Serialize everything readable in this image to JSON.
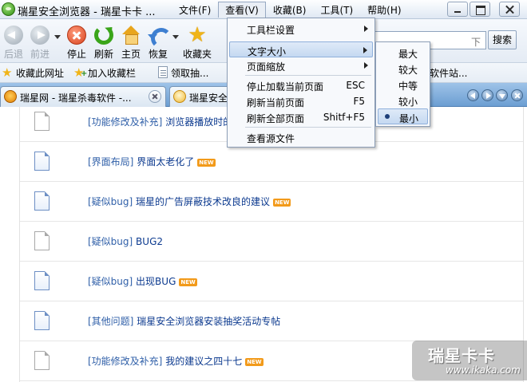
{
  "window": {
    "title": "瑞星安全浏览器 - 瑞星卡卡 ..."
  },
  "menubar": [
    {
      "label": "文件(F)"
    },
    {
      "label": "查看(V)"
    },
    {
      "label": "收藏(B)"
    },
    {
      "label": "工具(T)"
    },
    {
      "label": "帮助(H)"
    }
  ],
  "toolbar": {
    "back": "后退",
    "forward": "前进",
    "stop": "停止",
    "refresh": "刷新",
    "home": "主页",
    "restore": "恢复",
    "favorites": "收藏夹",
    "address_value": "下",
    "search": "搜索"
  },
  "favbar": {
    "add_url": "收藏此网址",
    "add_to_bar": "加入收藏栏",
    "item1": "领取抽...",
    "item2": "软件站..."
  },
  "tabs": [
    {
      "title": "瑞星网 - 瑞星杀毒软件 -..."
    },
    {
      "title": "瑞星安全"
    }
  ],
  "view_menu": {
    "items": [
      {
        "label": "工具栏设置",
        "shortcut": ""
      },
      {
        "label": "文字大小",
        "shortcut": ""
      },
      {
        "label": "页面缩放",
        "shortcut": ""
      },
      {
        "label": "停止加载当前页面",
        "shortcut": "ESC"
      },
      {
        "label": "刷新当前页面",
        "shortcut": "F5"
      },
      {
        "label": "刷新全部页面",
        "shortcut": "Shitf+F5"
      },
      {
        "label": "查看源文件",
        "shortcut": ""
      }
    ]
  },
  "font_size_menu": {
    "items": [
      {
        "label": "最大"
      },
      {
        "label": "较大"
      },
      {
        "label": "中等"
      },
      {
        "label": "较小"
      },
      {
        "label": "最小"
      }
    ],
    "selected": "最小"
  },
  "posts": [
    {
      "category": "[功能修改及补充]",
      "title": "浏览器播放时的屏蔽问题",
      "is_new": false,
      "icon": "gray"
    },
    {
      "category": "[界面布局]",
      "title": "界面太老化了",
      "is_new": true,
      "icon": "blue"
    },
    {
      "category": "[疑似bug]",
      "title": "瑞星的广告屏蔽技术改良的建议",
      "is_new": true,
      "icon": "blue"
    },
    {
      "category": "[疑似bug]",
      "title": "BUG2",
      "is_new": false,
      "icon": "gray"
    },
    {
      "category": "[疑似bug]",
      "title": "出现BUG",
      "is_new": true,
      "icon": "blue"
    },
    {
      "category": "[其他问题]",
      "title": "瑞星安全浏览器安装抽奖活动专帖",
      "is_new": false,
      "icon": "blue"
    },
    {
      "category": "[功能修改及补充]",
      "title": "我的建议之四十七",
      "is_new": true,
      "icon": "gray"
    }
  ],
  "new_badge": "NEW",
  "watermark": {
    "brand": "瑞星卡卡",
    "url": "www.ikaka.com"
  }
}
